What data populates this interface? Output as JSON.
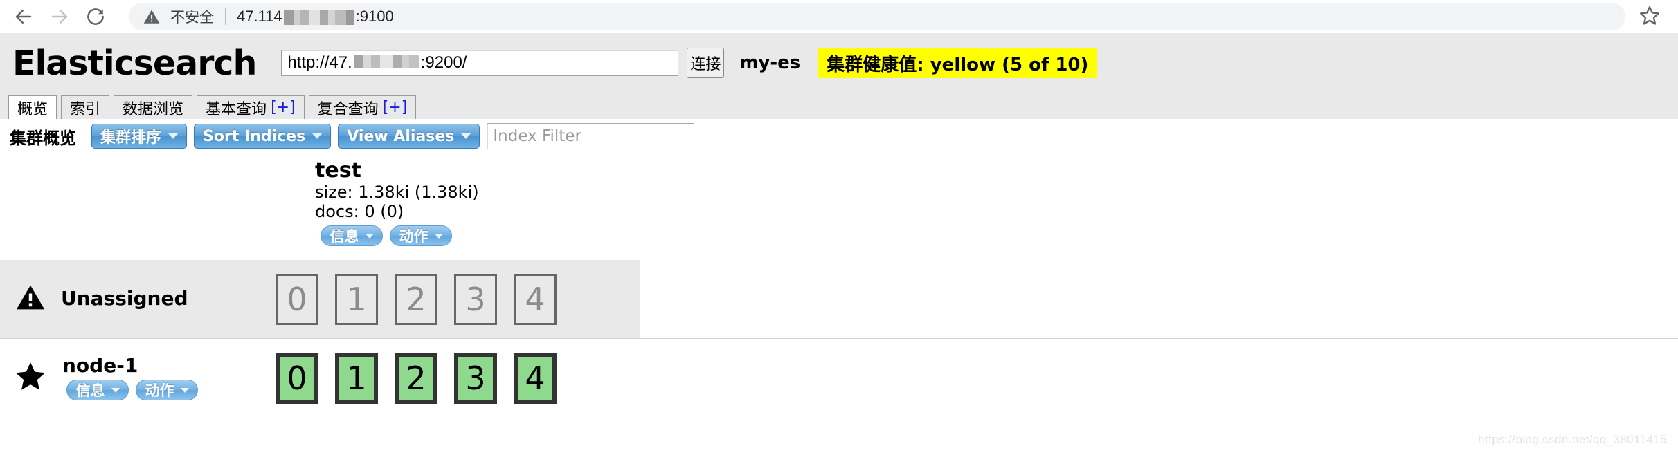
{
  "browser": {
    "back_icon": "arrow-left-icon",
    "forward_icon": "arrow-right-icon",
    "reload_icon": "reload-icon",
    "security_icon": "warning-triangle-icon",
    "security_label": "不安全",
    "url_prefix": "47.114",
    "url_suffix": ":9100",
    "bookmark_icon": "star-outline-icon"
  },
  "app": {
    "logo": "Elasticsearch",
    "connect_input": {
      "value_prefix": "http://47.",
      "value_suffix": ":9200/",
      "placeholder": "http://localhost:9200/"
    },
    "connect_button": "连接",
    "cluster_name": "my-es",
    "health_badge": "集群健康值: yellow (5 of 10)",
    "health_color": "#ffff00"
  },
  "tabs": [
    {
      "label": "概览",
      "plus": "",
      "active": true
    },
    {
      "label": "索引",
      "plus": "",
      "active": false
    },
    {
      "label": "数据浏览",
      "plus": "",
      "active": false
    },
    {
      "label": "基本查询",
      "plus": "[+]",
      "active": false
    },
    {
      "label": "复合查询",
      "plus": "[+]",
      "active": false
    }
  ],
  "toolbar": {
    "title": "集群概览",
    "buttons": [
      {
        "label": "集群排序"
      },
      {
        "label": "Sort Indices"
      },
      {
        "label": "View Aliases"
      }
    ],
    "filter_placeholder": "Index Filter",
    "filter_value": ""
  },
  "index": {
    "name": "test",
    "size": "size: 1.38ki (1.38ki)",
    "docs": "docs: 0 (0)",
    "actions": [
      {
        "label": "信息"
      },
      {
        "label": "动作"
      }
    ]
  },
  "nodes": [
    {
      "icon": "warning-triangle-icon",
      "name": "Unassigned",
      "state": "unassigned",
      "actions": [],
      "shards": [
        "0",
        "1",
        "2",
        "3",
        "4"
      ]
    },
    {
      "icon": "star-filled-icon",
      "name": "node-1",
      "state": "started",
      "actions": [
        {
          "label": "信息"
        },
        {
          "label": "动作"
        }
      ],
      "shards": [
        "0",
        "1",
        "2",
        "3",
        "4"
      ]
    }
  ],
  "watermark": "https://blog.csdn.net/qq_38011415"
}
